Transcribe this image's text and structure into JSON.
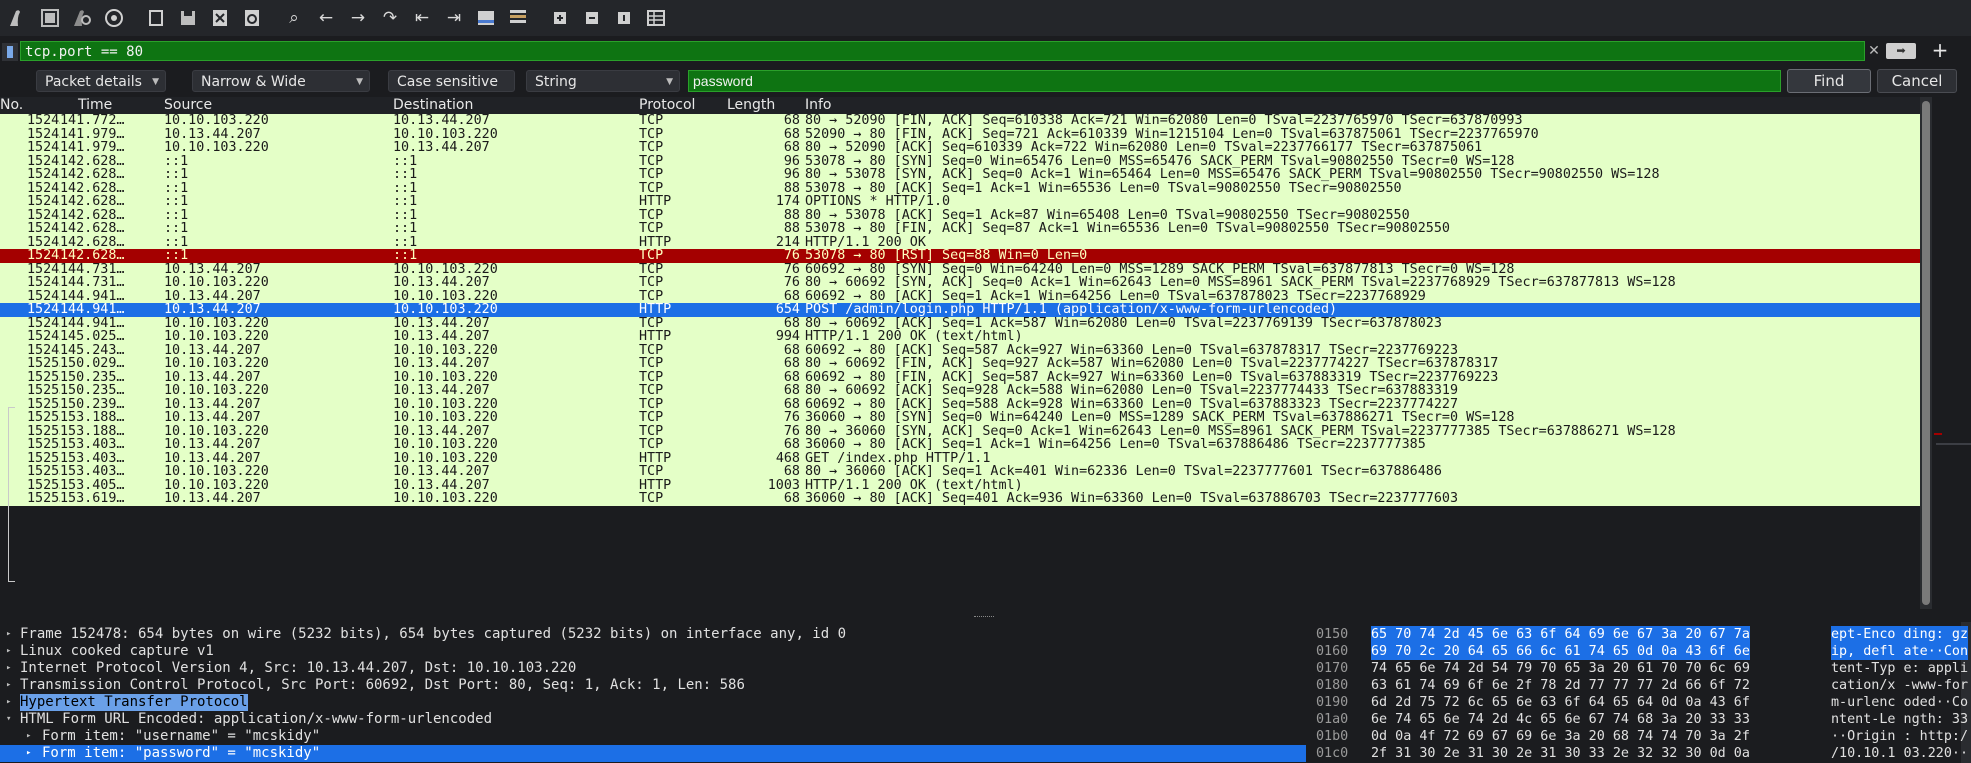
{
  "toolbar": {
    "icons": [
      "shark-fin-start-icon",
      "stop-capture-icon",
      "restart-capture-icon",
      "capture-options-icon",
      "open-file-icon",
      "save-file-icon",
      "close-file-icon",
      "reload-file-icon",
      "find-packet-icon",
      "go-back-icon",
      "go-forward-icon",
      "go-to-packet-icon",
      "go-first-icon",
      "go-last-icon",
      "auto-scroll-icon",
      "colorize-icon",
      "zoom-in-icon",
      "zoom-out-icon",
      "zoom-normal-icon",
      "resize-columns-icon"
    ]
  },
  "filter": {
    "value": "tcp.port == 80"
  },
  "find": {
    "search_in": "Packet details",
    "char_width": "Narrow & Wide",
    "case_label": "Case sensitive",
    "search_type": "String",
    "search_value": "password",
    "find_label": "Find",
    "cancel_label": "Cancel"
  },
  "packet_list": {
    "columns": [
      "No.",
      "Time",
      "Source",
      "Destination",
      "Protocol",
      "Length",
      "Info"
    ],
    "rows": [
      {
        "no": "1524…",
        "time": "141.772…",
        "src": "10.10.103.220",
        "dst": "10.13.44.207",
        "proto": "TCP",
        "len": "68",
        "info": "80 → 52090 [FIN, ACK] Seq=610338 Ack=721 Win=62080 Len=0 TSval=2237765970 TSecr=637870993",
        "style": "normal"
      },
      {
        "no": "1524…",
        "time": "141.979…",
        "src": "10.13.44.207",
        "dst": "10.10.103.220",
        "proto": "TCP",
        "len": "68",
        "info": "52090 → 80 [FIN, ACK] Seq=721 Ack=610339 Win=1215104 Len=0 TSval=637875061 TSecr=2237765970",
        "style": "normal"
      },
      {
        "no": "1524…",
        "time": "141.979…",
        "src": "10.10.103.220",
        "dst": "10.13.44.207",
        "proto": "TCP",
        "len": "68",
        "info": "80 → 52090 [ACK] Seq=610339 Ack=722 Win=62080 Len=0 TSval=2237766177 TSecr=637875061",
        "style": "normal"
      },
      {
        "no": "1524…",
        "time": "142.628…",
        "src": "::1",
        "dst": "::1",
        "proto": "TCP",
        "len": "96",
        "info": "53078 → 80 [SYN] Seq=0 Win=65476 Len=0 MSS=65476 SACK_PERM TSval=90802550 TSecr=0 WS=128",
        "style": "normal"
      },
      {
        "no": "1524…",
        "time": "142.628…",
        "src": "::1",
        "dst": "::1",
        "proto": "TCP",
        "len": "96",
        "info": "80 → 53078 [SYN, ACK] Seq=0 Ack=1 Win=65464 Len=0 MSS=65476 SACK_PERM TSval=90802550 TSecr=90802550 WS=128",
        "style": "normal"
      },
      {
        "no": "1524…",
        "time": "142.628…",
        "src": "::1",
        "dst": "::1",
        "proto": "TCP",
        "len": "88",
        "info": "53078 → 80 [ACK] Seq=1 Ack=1 Win=65536 Len=0 TSval=90802550 TSecr=90802550",
        "style": "normal"
      },
      {
        "no": "1524…",
        "time": "142.628…",
        "src": "::1",
        "dst": "::1",
        "proto": "HTTP",
        "len": "174",
        "info": "OPTIONS * HTTP/1.0",
        "style": "http"
      },
      {
        "no": "1524…",
        "time": "142.628…",
        "src": "::1",
        "dst": "::1",
        "proto": "TCP",
        "len": "88",
        "info": "80 → 53078 [ACK] Seq=1 Ack=87 Win=65408 Len=0 TSval=90802550 TSecr=90802550",
        "style": "normal"
      },
      {
        "no": "1524…",
        "time": "142.628…",
        "src": "::1",
        "dst": "::1",
        "proto": "TCP",
        "len": "88",
        "info": "53078 → 80 [FIN, ACK] Seq=87 Ack=1 Win=65536 Len=0 TSval=90802550 TSecr=90802550",
        "style": "normal"
      },
      {
        "no": "1524…",
        "time": "142.628…",
        "src": "::1",
        "dst": "::1",
        "proto": "HTTP",
        "len": "214",
        "info": "HTTP/1.1 200 OK",
        "style": "http"
      },
      {
        "no": "1524…",
        "time": "142.628…",
        "src": "::1",
        "dst": "::1",
        "proto": "TCP",
        "len": "76",
        "info": "53078 → 80 [RST] Seq=88 Win=0 Len=0",
        "style": "rst"
      },
      {
        "no": "1524…",
        "time": "144.731…",
        "src": "10.13.44.207",
        "dst": "10.10.103.220",
        "proto": "TCP",
        "len": "76",
        "info": "60692 → 80 [SYN] Seq=0 Win=64240 Len=0 MSS=1289 SACK_PERM TSval=637877813 TSecr=0 WS=128",
        "style": "normal"
      },
      {
        "no": "1524…",
        "time": "144.731…",
        "src": "10.10.103.220",
        "dst": "10.13.44.207",
        "proto": "TCP",
        "len": "76",
        "info": "80 → 60692 [SYN, ACK] Seq=0 Ack=1 Win=62643 Len=0 MSS=8961 SACK_PERM TSval=2237768929 TSecr=637877813 WS=128",
        "style": "normal"
      },
      {
        "no": "1524…",
        "time": "144.941…",
        "src": "10.13.44.207",
        "dst": "10.10.103.220",
        "proto": "TCP",
        "len": "68",
        "info": "60692 → 80 [ACK] Seq=1 Ack=1 Win=64256 Len=0 TSval=637878023 TSecr=2237768929",
        "style": "normal"
      },
      {
        "no": "1524…",
        "time": "144.941…",
        "src": "10.13.44.207",
        "dst": "10.10.103.220",
        "proto": "HTTP",
        "len": "654",
        "info": "POST /admin/login.php HTTP/1.1  (application/x-www-form-urlencoded)",
        "style": "sel"
      },
      {
        "no": "1524…",
        "time": "144.941…",
        "src": "10.10.103.220",
        "dst": "10.13.44.207",
        "proto": "TCP",
        "len": "68",
        "info": "80 → 60692 [ACK] Seq=1 Ack=587 Win=62080 Len=0 TSval=2237769139 TSecr=637878023",
        "style": "normal"
      },
      {
        "no": "1524…",
        "time": "145.025…",
        "src": "10.10.103.220",
        "dst": "10.13.44.207",
        "proto": "HTTP",
        "len": "994",
        "info": "HTTP/1.1 200 OK  (text/html)",
        "style": "http"
      },
      {
        "no": "1524…",
        "time": "145.243…",
        "src": "10.13.44.207",
        "dst": "10.10.103.220",
        "proto": "TCP",
        "len": "68",
        "info": "60692 → 80 [ACK] Seq=587 Ack=927 Win=63360 Len=0 TSval=637878317 TSecr=2237769223",
        "style": "normal"
      },
      {
        "no": "1525…",
        "time": "150.029…",
        "src": "10.10.103.220",
        "dst": "10.13.44.207",
        "proto": "TCP",
        "len": "68",
        "info": "80 → 60692 [FIN, ACK] Seq=927 Ack=587 Win=62080 Len=0 TSval=2237774227 TSecr=637878317",
        "style": "normal"
      },
      {
        "no": "1525…",
        "time": "150.235…",
        "src": "10.13.44.207",
        "dst": "10.10.103.220",
        "proto": "TCP",
        "len": "68",
        "info": "60692 → 80 [FIN, ACK] Seq=587 Ack=927 Win=63360 Len=0 TSval=637883319 TSecr=2237769223",
        "style": "normal"
      },
      {
        "no": "1525…",
        "time": "150.235…",
        "src": "10.10.103.220",
        "dst": "10.13.44.207",
        "proto": "TCP",
        "len": "68",
        "info": "80 → 60692 [ACK] Seq=928 Ack=588 Win=62080 Len=0 TSval=2237774433 TSecr=637883319",
        "style": "normal"
      },
      {
        "no": "1525…",
        "time": "150.239…",
        "src": "10.13.44.207",
        "dst": "10.10.103.220",
        "proto": "TCP",
        "len": "68",
        "info": "60692 → 80 [ACK] Seq=588 Ack=928 Win=63360 Len=0 TSval=637883323 TSecr=2237774227",
        "style": "normal"
      },
      {
        "no": "1525…",
        "time": "153.188…",
        "src": "10.13.44.207",
        "dst": "10.10.103.220",
        "proto": "TCP",
        "len": "76",
        "info": "36060 → 80 [SYN] Seq=0 Win=64240 Len=0 MSS=1289 SACK_PERM TSval=637886271 TSecr=0 WS=128",
        "style": "normal"
      },
      {
        "no": "1525…",
        "time": "153.188…",
        "src": "10.10.103.220",
        "dst": "10.13.44.207",
        "proto": "TCP",
        "len": "76",
        "info": "80 → 36060 [SYN, ACK] Seq=0 Ack=1 Win=62643 Len=0 MSS=8961 SACK_PERM TSval=2237777385 TSecr=637886271 WS=128",
        "style": "normal"
      },
      {
        "no": "1525…",
        "time": "153.403…",
        "src": "10.13.44.207",
        "dst": "10.10.103.220",
        "proto": "TCP",
        "len": "68",
        "info": "36060 → 80 [ACK] Seq=1 Ack=1 Win=64256 Len=0 TSval=637886486 TSecr=2237777385",
        "style": "normal"
      },
      {
        "no": "1525…",
        "time": "153.403…",
        "src": "10.13.44.207",
        "dst": "10.10.103.220",
        "proto": "HTTP",
        "len": "468",
        "info": "GET /index.php HTTP/1.1",
        "style": "http"
      },
      {
        "no": "1525…",
        "time": "153.403…",
        "src": "10.10.103.220",
        "dst": "10.13.44.207",
        "proto": "TCP",
        "len": "68",
        "info": "80 → 36060 [ACK] Seq=1 Ack=401 Win=62336 Len=0 TSval=2237777601 TSecr=637886486",
        "style": "normal"
      },
      {
        "no": "1525…",
        "time": "153.405…",
        "src": "10.10.103.220",
        "dst": "10.13.44.207",
        "proto": "HTTP",
        "len": "1003",
        "info": "HTTP/1.1 200 OK  (text/html)",
        "style": "http"
      },
      {
        "no": "1525…",
        "time": "153.619…",
        "src": "10.13.44.207",
        "dst": "10.10.103.220",
        "proto": "TCP",
        "len": "68",
        "info": "36060 → 80 [ACK] Seq=401 Ack=936 Win=63360 Len=0 TSval=637886703 TSecr=2237777603",
        "style": "normal"
      }
    ]
  },
  "details": {
    "rows": [
      {
        "text": "Frame 152478: 654 bytes on wire (5232 bits), 654 bytes captured (5232 bits) on interface any, id 0",
        "indent": 0,
        "style": "normal",
        "expanded": false
      },
      {
        "text": "Linux cooked capture v1",
        "indent": 0,
        "style": "normal",
        "expanded": false
      },
      {
        "text": "Internet Protocol Version 4, Src: 10.13.44.207, Dst: 10.10.103.220",
        "indent": 0,
        "style": "normal",
        "expanded": false
      },
      {
        "text": "Transmission Control Protocol, Src Port: 60692, Dst Port: 80, Seq: 1, Ack: 1, Len: 586",
        "indent": 0,
        "style": "normal",
        "expanded": false
      },
      {
        "text": "Hypertext Transfer Protocol",
        "indent": 0,
        "style": "hl2",
        "expanded": false
      },
      {
        "text": "HTML Form URL Encoded: application/x-www-form-urlencoded",
        "indent": 0,
        "style": "normal",
        "expanded": true
      },
      {
        "text": "Form item: \"username\" = \"mcskidy\"",
        "indent": 1,
        "style": "normal",
        "expanded": false
      },
      {
        "text": "Form item: \"password\" = \"mcskidy\"",
        "indent": 1,
        "style": "sel",
        "expanded": false
      }
    ]
  },
  "bytes": {
    "rows": [
      {
        "offset": "0150",
        "hex": "65 70 74 2d 45 6e 63 6f  64 69 6e 67 3a 20 67 7a",
        "ascii": "ept-Enco ding: gz",
        "sel": true
      },
      {
        "offset": "0160",
        "hex": "69 70 2c 20 64 65 66 6c  61 74 65 0d 0a 43 6f 6e",
        "ascii": "ip, defl ate··Con",
        "sel": true
      },
      {
        "offset": "0170",
        "hex": "74 65 6e 74 2d 54 79 70  65 3a 20 61 70 70 6c 69",
        "ascii": "tent-Typ e: appli",
        "sel": false
      },
      {
        "offset": "0180",
        "hex": "63 61 74 69 6f 6e 2f 78  2d 77 77 77 2d 66 6f 72",
        "ascii": "cation/x -www-for",
        "sel": false
      },
      {
        "offset": "0190",
        "hex": "6d 2d 75 72 6c 65 6e 63  6f 64 65 64 0d 0a 43 6f",
        "ascii": "m-urlenc oded··Co",
        "sel": false
      },
      {
        "offset": "01a0",
        "hex": "6e 74 65 6e 74 2d 4c 65  6e 67 74 68 3a 20 33 33",
        "ascii": "ntent-Le ngth: 33",
        "sel": false
      },
      {
        "offset": "01b0",
        "hex": "0d 0a 4f 72 69 67 69 6e  3a 20 68 74 74 70 3a 2f",
        "ascii": "··Origin : http:/",
        "sel": false
      },
      {
        "offset": "01c0",
        "hex": "2f 31 30 2e 31 30 2e 31  30 33 2e 32 32 30 0d 0a",
        "ascii": "/10.10.1 03.220··",
        "sel": false
      }
    ]
  }
}
